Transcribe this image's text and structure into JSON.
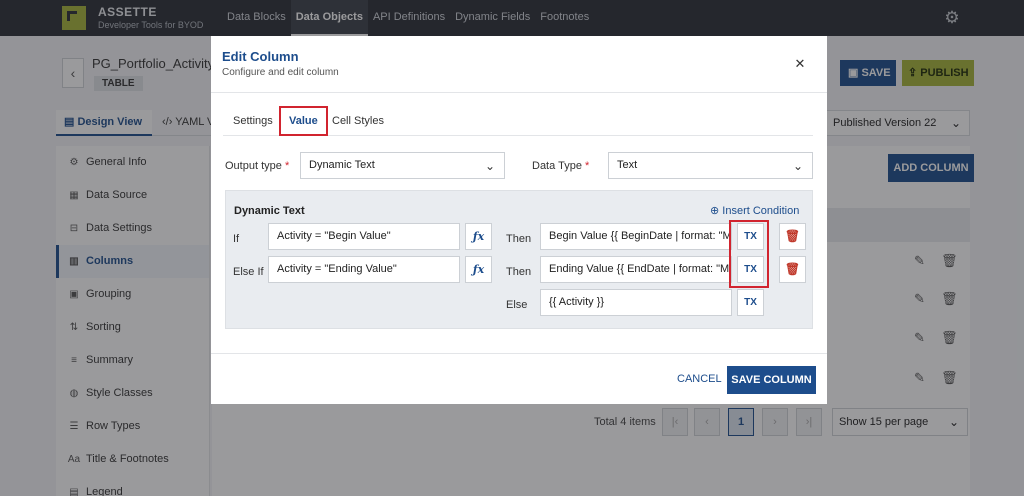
{
  "app": {
    "brand": "ASSETTE",
    "subtitle": "Developer Tools for BYOD"
  },
  "nav": [
    "Data Blocks",
    "Data Objects",
    "API Definitions",
    "Dynamic Fields",
    "Footnotes"
  ],
  "nav_active": "Data Objects",
  "page": {
    "title": "PG_Portfolio_Activity_",
    "badge": "TABLE",
    "save": "SAVE",
    "publish": "PUBLISH",
    "tab_design": "Design View",
    "tab_yaml": "YAML V",
    "version": "Published Version 22",
    "add_column": "ADD COLUMN",
    "pager_total": "Total 4 items",
    "page_current": "1",
    "per_page": "Show 15 per page"
  },
  "sidebar": [
    {
      "label": "General Info",
      "icon": "gear-icon"
    },
    {
      "label": "Data Source",
      "icon": "grid-icon"
    },
    {
      "label": "Data Settings",
      "icon": "sliders-icon"
    },
    {
      "label": "Columns",
      "icon": "columns-icon"
    },
    {
      "label": "Grouping",
      "icon": "group-icon"
    },
    {
      "label": "Sorting",
      "icon": "sort-icon"
    },
    {
      "label": "Summary",
      "icon": "list-icon"
    },
    {
      "label": "Style Classes",
      "icon": "palette-icon"
    },
    {
      "label": "Row Types",
      "icon": "rows-icon"
    },
    {
      "label": "Title & Footnotes",
      "icon": "text-icon"
    },
    {
      "label": "Legend",
      "icon": "legend-icon"
    }
  ],
  "sidebar_active": "Columns",
  "modal": {
    "title": "Edit Column",
    "subtitle": "Configure and edit column",
    "tabs": [
      "Settings",
      "Value",
      "Cell Styles"
    ],
    "active_tab": "Value",
    "output_type_label": "Output type",
    "output_type_value": "Dynamic Text",
    "data_type_label": "Data Type",
    "data_type_value": "Text",
    "dynamic_title": "Dynamic Text",
    "insert_condition": "Insert Condition",
    "if_label": "If",
    "elseif_label": "Else If",
    "then_label": "Then",
    "else_label": "Else",
    "cond1": "Activity = \"Begin Value\"",
    "cond2": "Activity = \"Ending Value\"",
    "then1": "Begin Value {{ BeginDate | format: \"MM",
    "then2": "Ending Value {{ EndDate | format: \"MM",
    "else_value": "{{ Activity }}",
    "tx": "TX",
    "cancel": "CANCEL",
    "save_column": "SAVE COLUMN"
  },
  "colors": {
    "primary": "#1d4d8c",
    "accent": "#a6b43a",
    "highlight": "#d1242f",
    "topbar": "#2b2f36"
  }
}
